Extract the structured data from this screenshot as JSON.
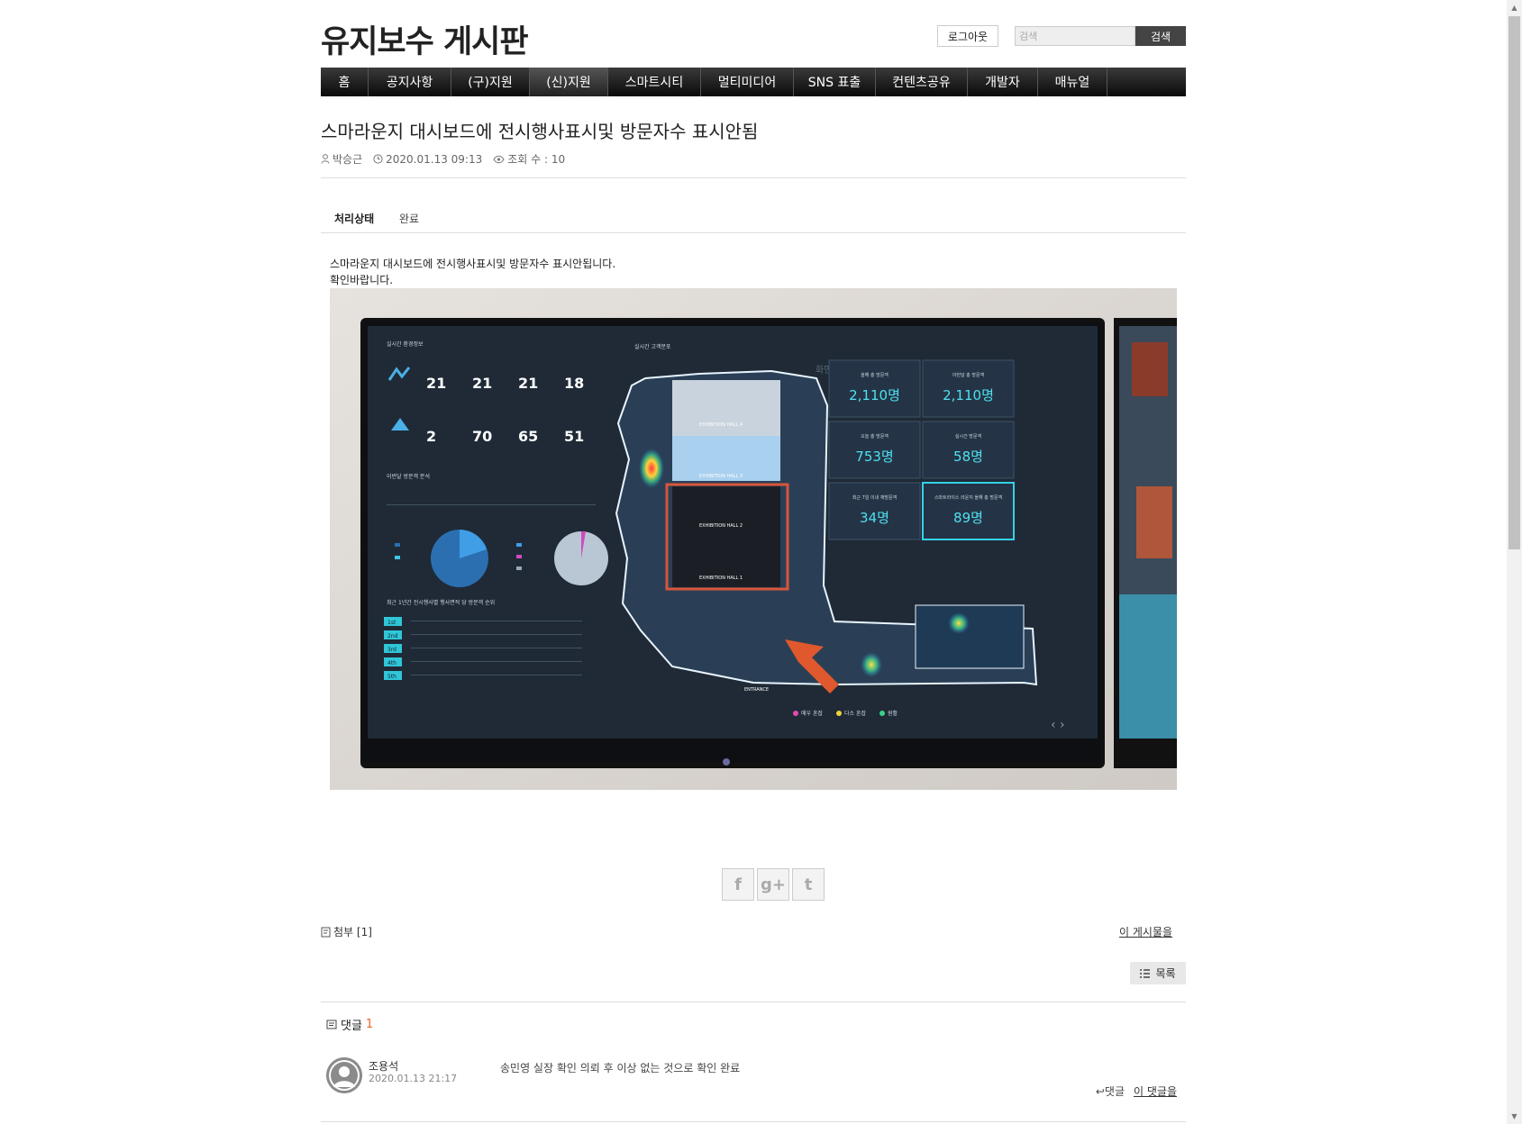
{
  "header": {
    "site_title": "유지보수 게시판",
    "logout_label": "로그아웃",
    "search_placeholder": "검색",
    "search_button": "검색"
  },
  "nav": {
    "items": [
      "홈",
      "공지사항",
      "(구)지원",
      "(신)지원",
      "스마트시티",
      "멀티미디어",
      "SNS 표출",
      "컨텐츠공유",
      "개발자",
      "매뉴얼"
    ]
  },
  "post": {
    "title": "스마라운지 대시보드에 전시행사표시및 방문자수 표시안됨",
    "author": "박승근",
    "datetime": "2020.01.13 09:13",
    "views": "조회 수 : 10",
    "status_label": "처리상태",
    "status_value": "완료",
    "body_line1": "스마라운지 대시보드에 전시행사표시및 방문자수 표시안됩니다.",
    "body_line2": "확인바랍니다."
  },
  "dashboard": {
    "env_title": "실시간 환경정보",
    "map_title": "실시간 고객분포",
    "touch_hint": "화면터치가 가능합니다",
    "env_row1": [
      "21",
      "21",
      "21",
      "18"
    ],
    "env_row2": [
      "2",
      "70",
      "65",
      "51"
    ],
    "hall_labels": [
      "EXHIBITION HALL 4",
      "EXHIBITION HALL 3",
      "EXHIBITION HALL 2",
      "EXHIBITION HALL 1"
    ],
    "entrance": "ENTRANCE",
    "kpis": [
      {
        "label": "올해 총 방문객",
        "value": "2,110",
        "unit": "명"
      },
      {
        "label": "이번달 총 방문객",
        "value": "2,110",
        "unit": "명"
      },
      {
        "label": "오늘 총 방문객",
        "value": "753",
        "unit": "명"
      },
      {
        "label": "실시간 방문객",
        "value": "58",
        "unit": "명"
      },
      {
        "label": "최근 7일 이내 재방문객",
        "value": "34",
        "unit": "명"
      },
      {
        "label": "스마트라이스 라운지 올해 총 방문객",
        "value": "89",
        "unit": "명"
      }
    ],
    "legend": [
      "매우 혼잡",
      "다소 혼잡",
      "원활"
    ],
    "table_title": "최근 1년간 전시행사별 행사면적 당 방문객 순위",
    "ranks": [
      "1st",
      "2nd",
      "3rd",
      "4th",
      "5th"
    ]
  },
  "share": {
    "facebook_icon": "f",
    "google_icon": "g+",
    "twitter_icon": "t"
  },
  "footer": {
    "attach": "첨부 [1]",
    "this_post": "이 게시물을",
    "list_button": "목록"
  },
  "comments": {
    "label": "댓글",
    "count": "1",
    "items": [
      {
        "author": "조용석",
        "datetime": "2020.01.13 21:17",
        "text": "송민영 실장 확인 의뢰 후 이상 없는 것으로 확인 완료",
        "reply": "댓글",
        "this_comment": "이 댓글을"
      }
    ]
  }
}
